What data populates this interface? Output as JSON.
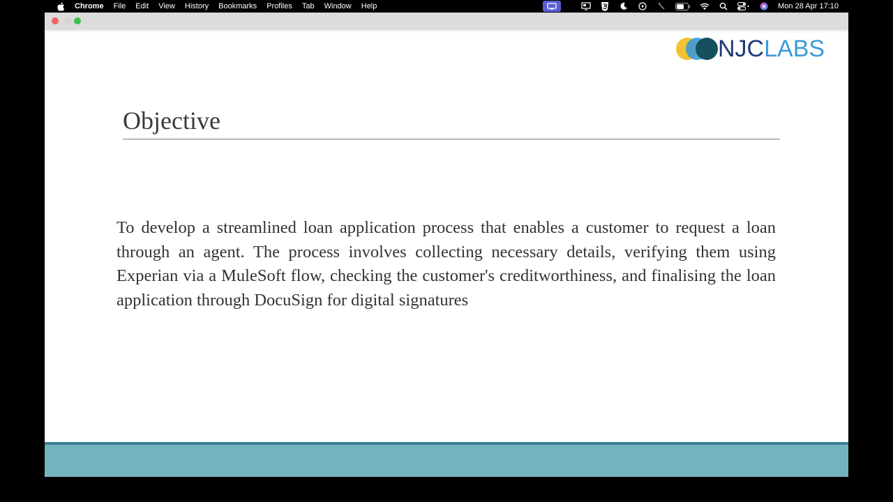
{
  "menubar": {
    "app_name": "Chrome",
    "items": [
      "File",
      "Edit",
      "View",
      "History",
      "Bookmarks",
      "Profiles",
      "Tab",
      "Window",
      "Help"
    ],
    "clock": "Mon 28 Apr  17:10"
  },
  "slide": {
    "logo_njc": "NJC",
    "logo_labs": "LABS",
    "title": "Objective",
    "body": "To develop a streamlined loan application process that enables a customer to request a loan through an agent. The process involves collecting necessary details, verifying them using Experian via a MuleSoft flow, checking the customer's creditworthiness, and finalising the loan application through DocuSign for digital signatures"
  },
  "colors": {
    "footer_band": "#73b3bd",
    "footer_line": "#3e7e97",
    "logo_navy": "#1e3a7a",
    "logo_blue": "#3b9bd6",
    "logo_yellow": "#f2c230",
    "screen_share": "#5b5fd6"
  },
  "icons": [
    "apple-icon",
    "screen-share-icon",
    "display-icon",
    "html5-icon",
    "moon-icon",
    "play-icon",
    "pen-icon",
    "battery-icon",
    "wifi-icon",
    "search-icon",
    "control-center-icon",
    "siri-icon"
  ]
}
